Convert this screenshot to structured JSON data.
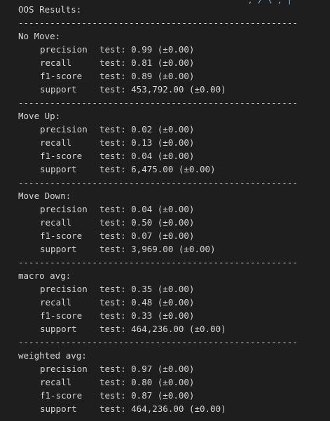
{
  "header": "OOS Results:",
  "separator": "-----------------------------------------------------",
  "top_clip": "'  ,  /  \\  ,  |",
  "sections": [
    {
      "title": "No Move:",
      "rows": [
        {
          "metric": "precision",
          "value": "test: 0.99 (±0.00)"
        },
        {
          "metric": "recall",
          "value": "test: 0.81 (±0.00)"
        },
        {
          "metric": "f1-score",
          "value": "test: 0.89 (±0.00)"
        },
        {
          "metric": "support",
          "value": "test: 453,792.00 (±0.00)"
        }
      ]
    },
    {
      "title": "Move Up:",
      "rows": [
        {
          "metric": "precision",
          "value": "test: 0.02 (±0.00)"
        },
        {
          "metric": "recall",
          "value": "test: 0.13 (±0.00)"
        },
        {
          "metric": "f1-score",
          "value": "test: 0.04 (±0.00)"
        },
        {
          "metric": "support",
          "value": "test: 6,475.00 (±0.00)"
        }
      ]
    },
    {
      "title": "Move Down:",
      "rows": [
        {
          "metric": "precision",
          "value": "test: 0.04 (±0.00)"
        },
        {
          "metric": "recall",
          "value": "test: 0.50 (±0.00)"
        },
        {
          "metric": "f1-score",
          "value": "test: 0.07 (±0.00)"
        },
        {
          "metric": "support",
          "value": "test: 3,969.00 (±0.00)"
        }
      ]
    },
    {
      "title": "macro avg:",
      "rows": [
        {
          "metric": "precision",
          "value": "test: 0.35 (±0.00)"
        },
        {
          "metric": "recall",
          "value": "test: 0.48 (±0.00)"
        },
        {
          "metric": "f1-score",
          "value": "test: 0.33 (±0.00)"
        },
        {
          "metric": "support",
          "value": "test: 464,236.00 (±0.00)"
        }
      ]
    },
    {
      "title": "weighted avg:",
      "rows": [
        {
          "metric": "precision",
          "value": "test: 0.97 (±0.00)"
        },
        {
          "metric": "recall",
          "value": "test: 0.80 (±0.00)"
        },
        {
          "metric": "f1-score",
          "value": "test: 0.87 (±0.00)"
        },
        {
          "metric": "support",
          "value": "test: 464,236.00 (±0.00)"
        }
      ]
    }
  ]
}
